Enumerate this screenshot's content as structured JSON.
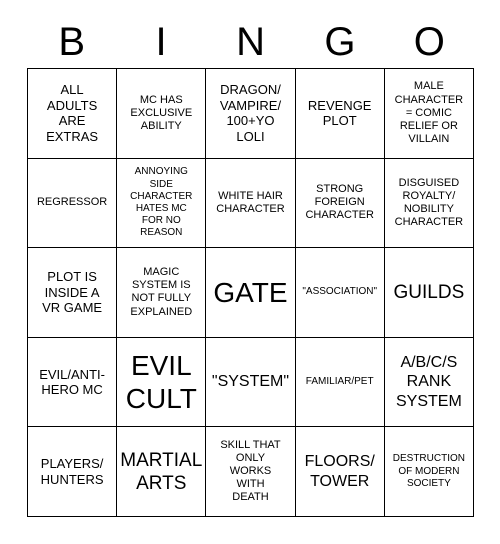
{
  "card": {
    "title_letters": [
      "B",
      "I",
      "N",
      "G",
      "O"
    ],
    "columns": 5,
    "rows": 5,
    "background_color": "#ffffff",
    "text_color": "#000000",
    "border_color": "#000000"
  },
  "cells": [
    {
      "text": "ALL\nADULTS\nARE\nEXTRAS",
      "size": "md",
      "row": 1,
      "col": 1
    },
    {
      "text": "MC HAS\nEXCLUSIVE\nABILITY",
      "size": "sm",
      "row": 1,
      "col": 2
    },
    {
      "text": "DRAGON/\nVAMPIRE/\n100+YO\nLOLI",
      "size": "md",
      "row": 1,
      "col": 3
    },
    {
      "text": "REVENGE\nPLOT",
      "size": "md",
      "row": 1,
      "col": 4
    },
    {
      "text": "MALE\nCHARACTER\n= COMIC\nRELIEF OR\nVILLAIN",
      "size": "sm",
      "row": 1,
      "col": 5
    },
    {
      "text": "REGRESSOR",
      "size": "sm",
      "row": 2,
      "col": 1
    },
    {
      "text": "ANNOYING\nSIDE\nCHARACTER\nHATES MC\nFOR NO\nREASON",
      "size": "xs",
      "row": 2,
      "col": 2
    },
    {
      "text": "WHITE HAIR\nCHARACTER",
      "size": "sm",
      "row": 2,
      "col": 3
    },
    {
      "text": "STRONG\nFOREIGN\nCHARACTER",
      "size": "sm",
      "row": 2,
      "col": 4
    },
    {
      "text": "DISGUISED\nROYALTY/\nNOBILITY\nCHARACTER",
      "size": "sm",
      "row": 2,
      "col": 5
    },
    {
      "text": "PLOT IS\nINSIDE A\nVR GAME",
      "size": "md",
      "row": 3,
      "col": 1
    },
    {
      "text": "MAGIC\nSYSTEM IS\nNOT FULLY\nEXPLAINED",
      "size": "sm",
      "row": 3,
      "col": 2
    },
    {
      "text": "GATE",
      "size": "xxl",
      "row": 3,
      "col": 3
    },
    {
      "text": "\"ASSOCIATION\"",
      "size": "xs",
      "row": 3,
      "col": 4
    },
    {
      "text": "GUILDS",
      "size": "xl",
      "row": 3,
      "col": 5
    },
    {
      "text": "EVIL/ANTI-\nHERO MC",
      "size": "md",
      "row": 4,
      "col": 1
    },
    {
      "text": "EVIL\nCULT",
      "size": "xxl",
      "row": 4,
      "col": 2
    },
    {
      "text": "\"SYSTEM\"",
      "size": "lg",
      "row": 4,
      "col": 3
    },
    {
      "text": "FAMILIAR/PET",
      "size": "xs",
      "row": 4,
      "col": 4
    },
    {
      "text": "A/B/C/S\nRANK\nSYSTEM",
      "size": "lg",
      "row": 4,
      "col": 5
    },
    {
      "text": "PLAYERS/\nHUNTERS",
      "size": "md",
      "row": 5,
      "col": 1
    },
    {
      "text": "MARTIAL\nARTS",
      "size": "xl",
      "row": 5,
      "col": 2
    },
    {
      "text": "SKILL THAT\nONLY\nWORKS\nWITH\nDEATH",
      "size": "sm",
      "row": 5,
      "col": 3
    },
    {
      "text": "FLOORS/\nTOWER",
      "size": "lg",
      "row": 5,
      "col": 4
    },
    {
      "text": "DESTRUCTION\nOF MODERN\nSOCIETY",
      "size": "xs",
      "row": 5,
      "col": 5
    }
  ]
}
